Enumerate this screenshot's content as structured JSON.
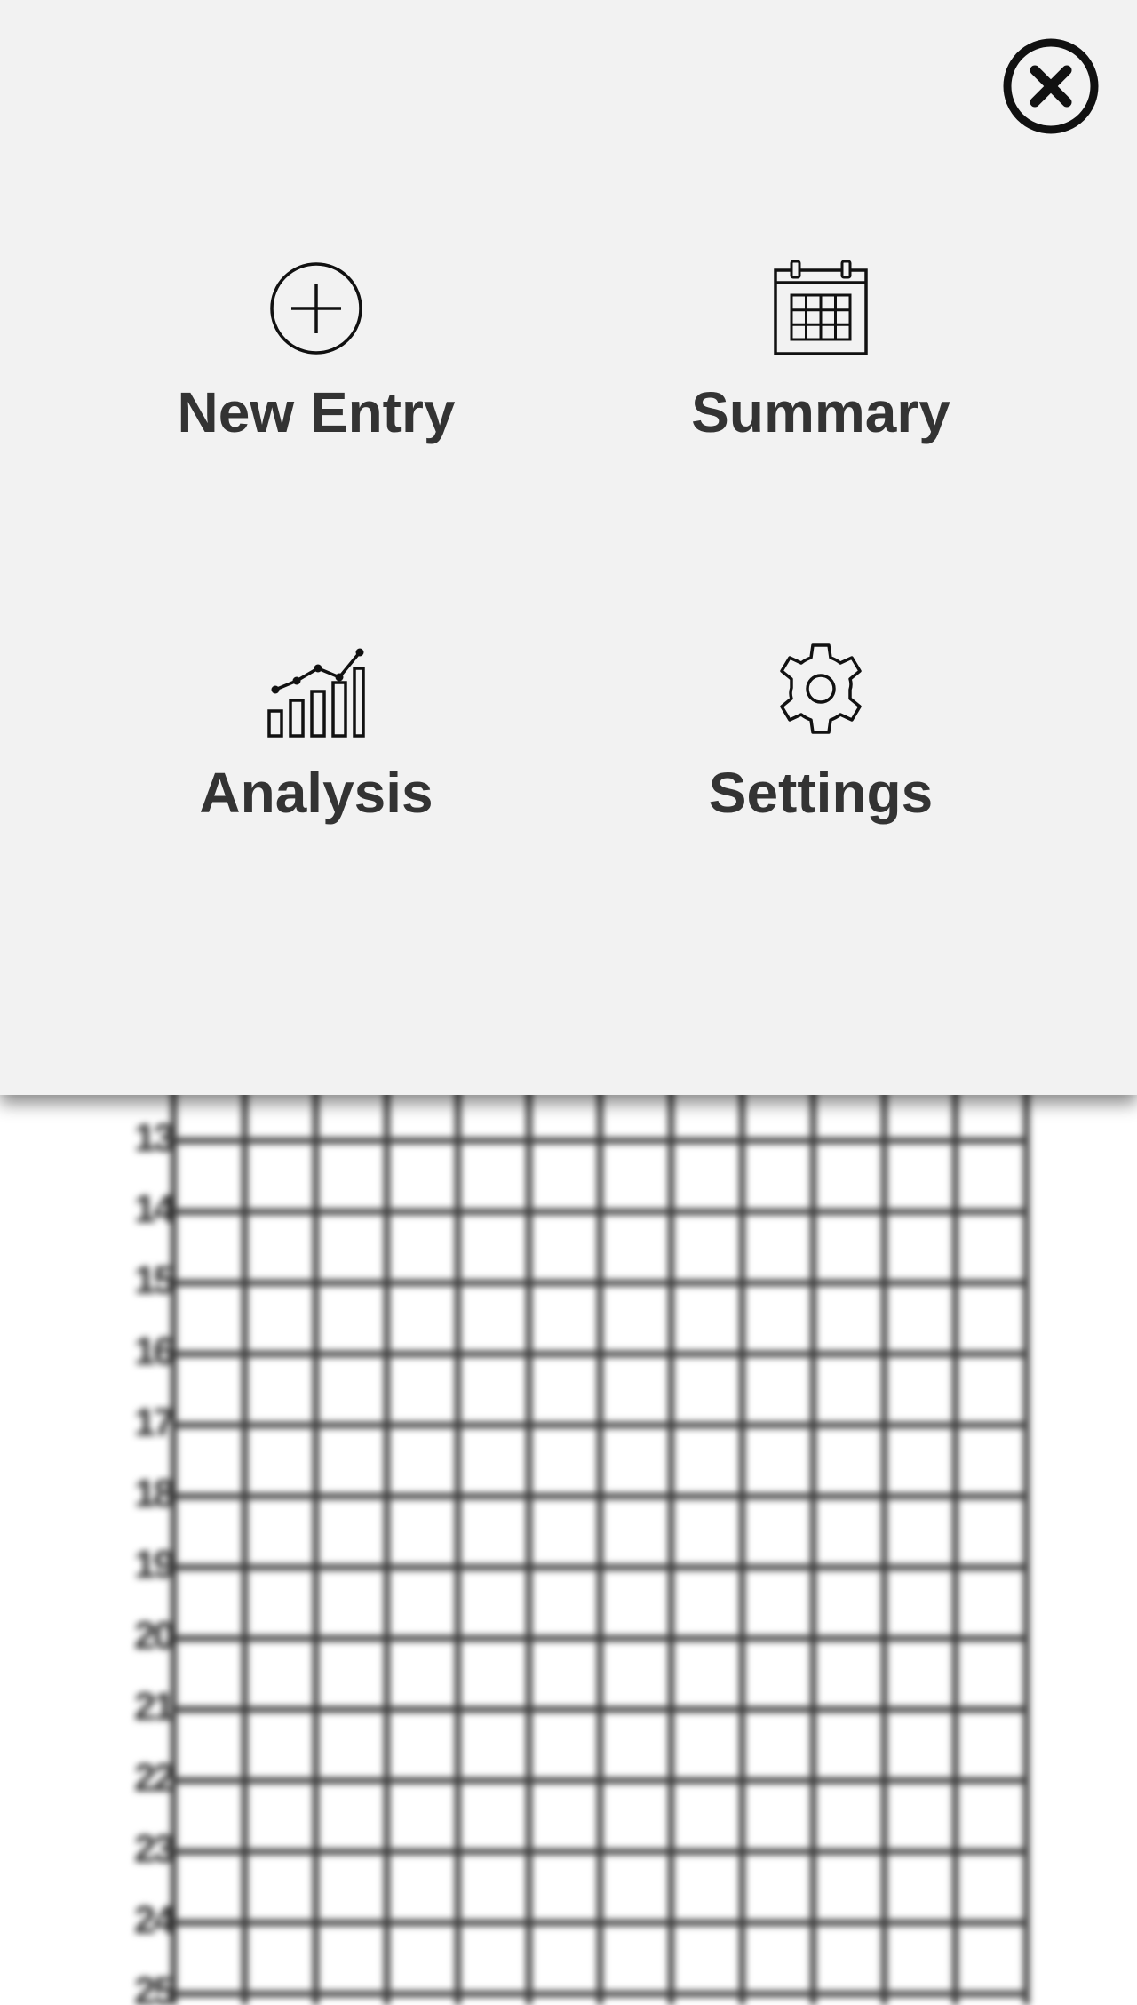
{
  "menu": {
    "close_icon": "close-circle-icon",
    "items": [
      {
        "label": "New Entry",
        "icon": "add-circle-icon"
      },
      {
        "label": "Summary",
        "icon": "calendar-icon"
      },
      {
        "label": "Analysis",
        "icon": "chart-icon"
      },
      {
        "label": "Settings",
        "icon": "gear-icon"
      }
    ]
  },
  "background": {
    "row_numbers": [
      "13",
      "14",
      "15",
      "16",
      "17",
      "18",
      "19",
      "20",
      "21",
      "22",
      "23",
      "24",
      "25"
    ]
  },
  "colors": {
    "panel_background": "#f2f2f2",
    "label_text": "#333333",
    "icon_stroke": "#111111"
  }
}
